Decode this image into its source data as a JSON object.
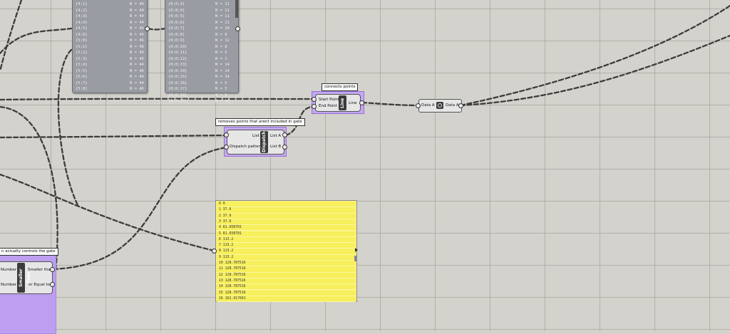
{
  "canvas": {
    "grid_color": "#96948c",
    "background": "#d4d2cc"
  },
  "panel_left": {
    "rows": [
      {
        "k": "{4;1}",
        "v": "N = 46"
      },
      {
        "k": "{4;2}",
        "v": "N = 44"
      },
      {
        "k": "{4;3}",
        "v": "N = 44"
      },
      {
        "k": "{4;4}",
        "v": "N = 44"
      },
      {
        "k": "{4;5}",
        "v": "N = 46"
      },
      {
        "k": "{4;6}",
        "v": "N = 46"
      },
      {
        "k": "{5;0}",
        "v": "N = 46"
      },
      {
        "k": "{5;1}",
        "v": "N = 46"
      },
      {
        "k": "{5;2}",
        "v": "N = 46"
      },
      {
        "k": "{5;3}",
        "v": "N = 46"
      },
      {
        "k": "{5;4}",
        "v": "N = 44"
      },
      {
        "k": "{5;5}",
        "v": "N = 46"
      },
      {
        "k": "{5;6}",
        "v": "N = 44"
      },
      {
        "k": "{5;7}",
        "v": "N = 44"
      },
      {
        "k": "{5;8}",
        "v": "N = 46"
      }
    ]
  },
  "panel_right": {
    "rows": [
      {
        "k": "{0;0;3}",
        "v": "N = 11"
      },
      {
        "k": "{0;0;4}",
        "v": "N = 11"
      },
      {
        "k": "{0;0;5}",
        "v": "N = 11"
      },
      {
        "k": "{0;0;6}",
        "v": "N = 11"
      },
      {
        "k": "{0;0;7}",
        "v": "N = 10"
      },
      {
        "k": "{0;0;8}",
        "v": "N = 8"
      },
      {
        "k": "{0;0;9}",
        "v": "N = 11"
      },
      {
        "k": "{0;0;10}",
        "v": "N = 8"
      },
      {
        "k": "{0;0;11}",
        "v": "N = 5"
      },
      {
        "k": "{0;0;12}",
        "v": "N = 1"
      },
      {
        "k": "{0;0;13}",
        "v": "N = 14"
      },
      {
        "k": "{0;0;14}",
        "v": "N = 14"
      },
      {
        "k": "{0;0;15}",
        "v": "N = 14"
      },
      {
        "k": "{0;0;16}",
        "v": "N = 5"
      },
      {
        "k": "{0;0;17}",
        "v": "N = 5"
      },
      {
        "k": "{0;0;18}",
        "v": "N = 5"
      },
      {
        "k": "{0;0;19}",
        "v": "N = 14"
      }
    ]
  },
  "line_comp": {
    "label": "connects points",
    "input1": "Start Point",
    "input2": "End Point",
    "name": "Line",
    "output": "Line"
  },
  "dispatch_comp": {
    "label": "removes points that arent included in gate",
    "input1": "List",
    "input2": "Dispatch pattern",
    "name": "Dispatch",
    "output1": "List A",
    "output2": "List B"
  },
  "data_comp": {
    "input": "Data A",
    "output": "Data A"
  },
  "smaller_comp": {
    "label": "n actually controls the gate",
    "input1": "Number",
    "input2": "Number",
    "name": "Smaller Than",
    "output1": "Smaller than",
    "output2": "or Equal to"
  },
  "yellow_panel": {
    "rows": [
      "0 0",
      "1 37.6",
      "2 37.6",
      "3 37.6",
      "4 81.658701",
      "5 81.658701",
      "6 113.2",
      "7 113.2",
      "8 113.2",
      "9 113.2",
      "10 128.787516",
      "11 128.787516",
      "12 128.787516",
      "13 128.787516",
      "14 128.787516",
      "15 128.787516",
      "16 162.917601"
    ]
  }
}
